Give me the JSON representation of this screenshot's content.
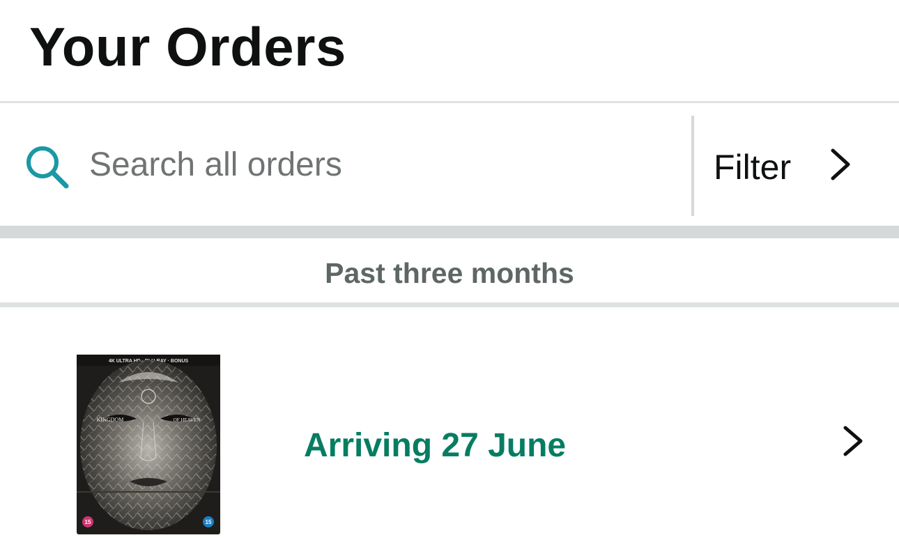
{
  "header": {
    "title": "Your Orders"
  },
  "search": {
    "icon": "search-icon",
    "placeholder": "Search all orders",
    "value": ""
  },
  "filter": {
    "label": "Filter",
    "icon": "chevron-right-icon"
  },
  "section": {
    "title": "Past three months"
  },
  "orders": [
    {
      "image": "kingdom-of-heaven-steelbook-cover",
      "status": "Arriving 27 June",
      "status_color": "#067d62",
      "icon": "chevron-right-icon",
      "cover_text": {
        "top_band": "4K ULTRA HD · BLU-RAY · BONUS",
        "title_left": "KINGDOM",
        "title_right": "OF HEAVEN",
        "rating_left": "15",
        "rating_right": "15"
      }
    }
  ],
  "colors": {
    "accent_teal": "#1a98a5",
    "status_green": "#067d62",
    "text_primary": "#0f1111",
    "text_secondary": "#5f6666",
    "divider": "#d5d9d9"
  }
}
